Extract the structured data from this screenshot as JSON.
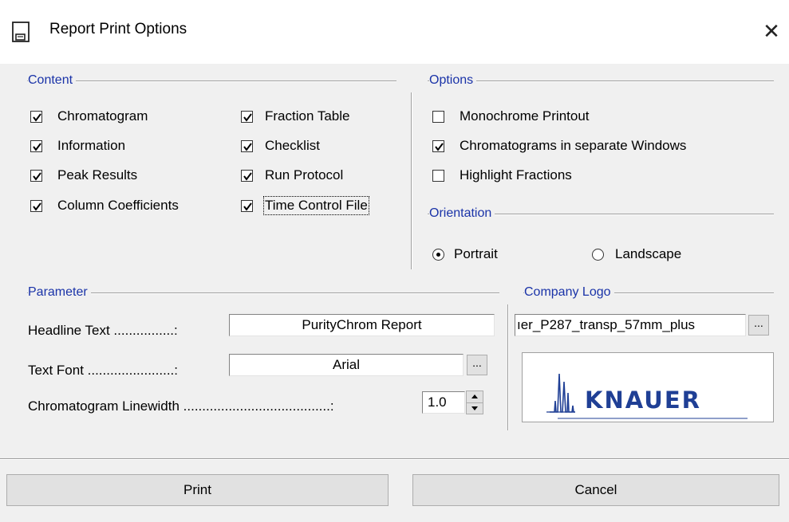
{
  "window": {
    "title": "Report Print Options",
    "icon": "report-document-icon",
    "close_glyph": "✕"
  },
  "content_group": {
    "title": "Content",
    "items": [
      {
        "label": "Chromatogram",
        "checked": true
      },
      {
        "label": "Information",
        "checked": true
      },
      {
        "label": "Peak Results",
        "checked": true
      },
      {
        "label": "Column Coefficients",
        "checked": true
      },
      {
        "label": "Fraction Table",
        "checked": true
      },
      {
        "label": "Checklist",
        "checked": true
      },
      {
        "label": "Run Protocol",
        "checked": true
      },
      {
        "label": "Time Control File",
        "checked": true
      }
    ]
  },
  "options_group": {
    "title": "Options",
    "items": [
      {
        "label": "Monochrome Printout",
        "checked": false
      },
      {
        "label": "Chromatograms in separate Windows",
        "checked": true
      },
      {
        "label": "Highlight Fractions",
        "checked": false
      }
    ]
  },
  "orientation_group": {
    "title": "Orientation",
    "options": [
      {
        "label": "Portrait",
        "selected": true
      },
      {
        "label": "Landscape",
        "selected": false
      }
    ]
  },
  "parameter_group": {
    "title": "Parameter",
    "headline_label": "Headline Text ................:",
    "headline_value": "PurityChrom Report",
    "font_label": "Text Font .......................:",
    "font_value": "Arial",
    "browse_label": "...",
    "linewidth_label": "Chromatogram Linewidth .......................................:",
    "linewidth_value": "1.0"
  },
  "logo_group": {
    "title": "Company Logo",
    "file_value": "ıer_P287_transp_57mm_plus",
    "browse_label": "...",
    "logo_text": "KNAUER",
    "brand_color": "#1f3f95"
  },
  "buttons": {
    "print": "Print",
    "cancel": "Cancel"
  }
}
